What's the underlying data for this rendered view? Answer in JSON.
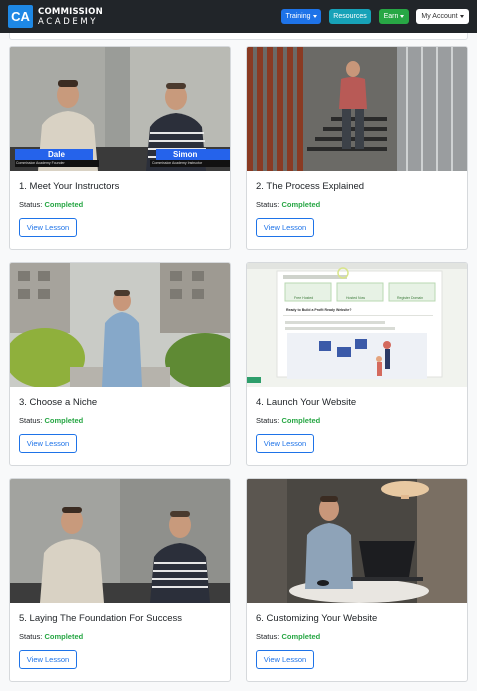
{
  "brand": {
    "logo": "CA",
    "line1": "COMMISSION",
    "line2": "ACADEMY"
  },
  "nav": {
    "training": "Training",
    "resources": "Resources",
    "earn": "Earn",
    "account": "My Account"
  },
  "colors": {
    "primary": "#1e73e8",
    "info": "#17a2b8",
    "success": "#28a745",
    "dark": "#212529"
  },
  "lessons": [
    {
      "title": "1. Meet Your Instructors",
      "status_label": "Status:",
      "status": "Completed",
      "button": "View Lesson",
      "overlay": {
        "left_name": "Dale",
        "left_role": "Commission Academy Founder",
        "right_name": "Simon",
        "right_role": "Commission Academy Instructor"
      }
    },
    {
      "title": "2. The Process Explained",
      "status_label": "Status:",
      "status": "Completed",
      "button": "View Lesson"
    },
    {
      "title": "3. Choose a Niche",
      "status_label": "Status:",
      "status": "Completed",
      "button": "View Lesson"
    },
    {
      "title": "4. Launch Your Website",
      "status_label": "Status:",
      "status": "Completed",
      "button": "View Lesson",
      "overlay": {
        "panel_heading": "Ready to Build a Profit Ready Website?",
        "btn_a": "Free Hosted",
        "btn_b": "Hosted Now",
        "btn_c": "Register Domain"
      }
    },
    {
      "title": "5. Laying The Foundation For Success",
      "status_label": "Status:",
      "status": "Completed",
      "button": "View Lesson"
    },
    {
      "title": "6. Customizing Your Website",
      "status_label": "Status:",
      "status": "Completed",
      "button": "View Lesson"
    }
  ]
}
